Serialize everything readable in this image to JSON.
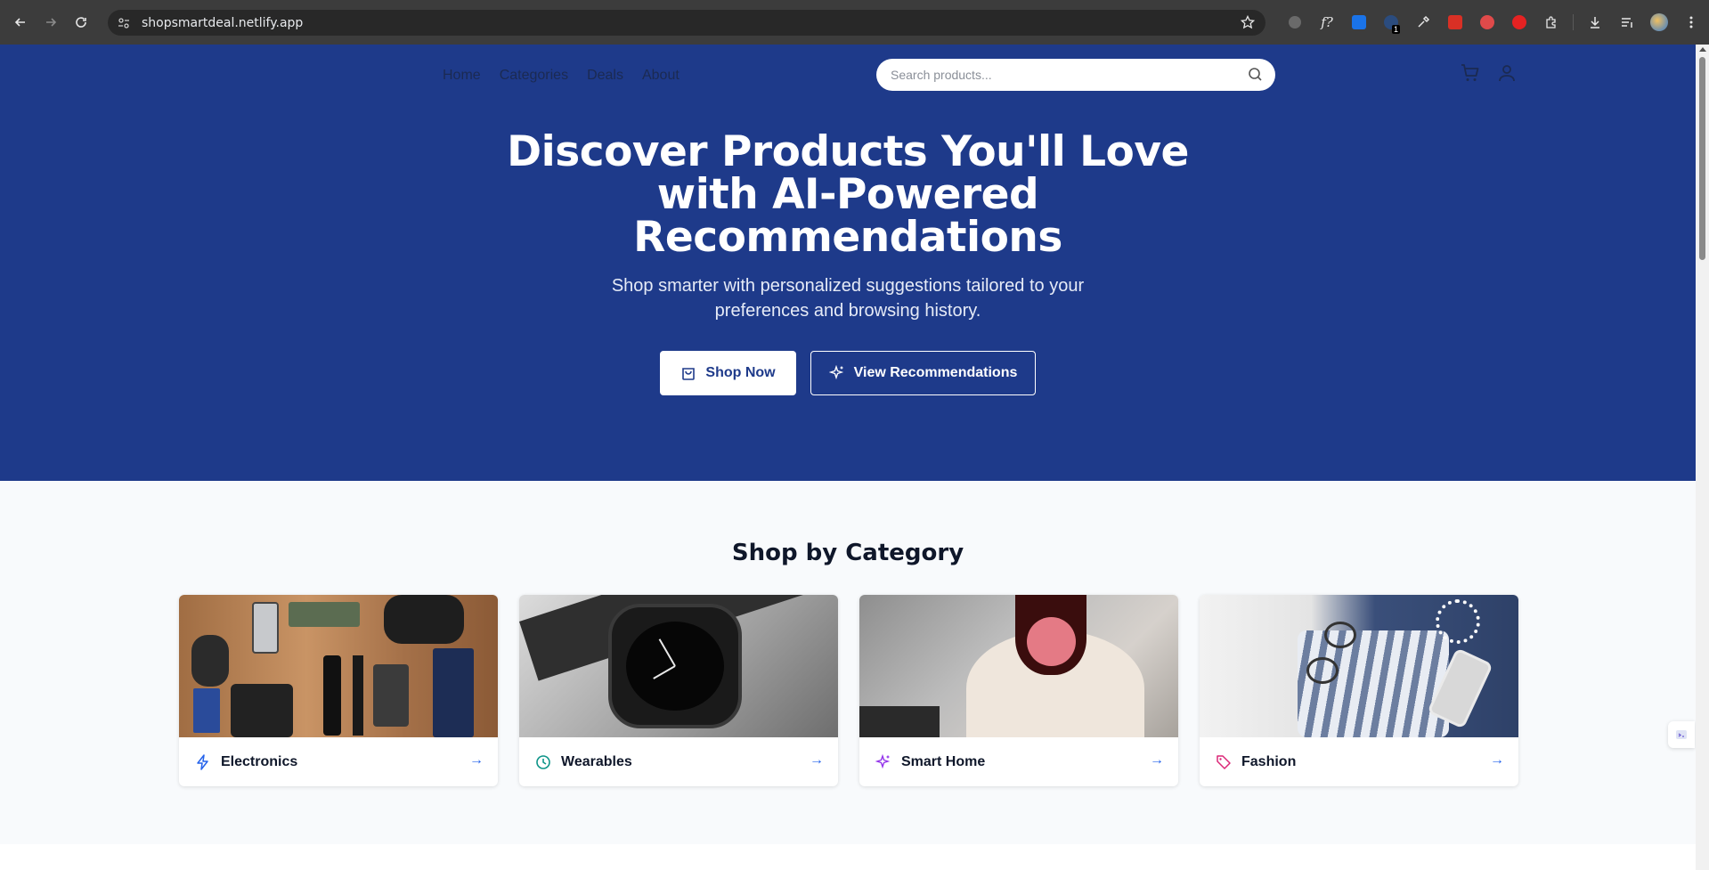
{
  "browser": {
    "url": "shopsmartdeal.netlify.app",
    "extension_badge": "1"
  },
  "nav": {
    "items": [
      {
        "label": "Home"
      },
      {
        "label": "Categories"
      },
      {
        "label": "Deals"
      },
      {
        "label": "About"
      }
    ],
    "search_placeholder": "Search products..."
  },
  "hero": {
    "title": "Discover Products You'll Love with AI-Powered Recommendations",
    "subtitle": "Shop smarter with personalized suggestions tailored to your preferences and browsing history.",
    "primary_button": "Shop Now",
    "secondary_button": "View Recommendations",
    "background_color": "#1e3a8a"
  },
  "categories": {
    "title": "Shop by Category",
    "items": [
      {
        "label": "Electronics",
        "icon": "lightning-icon",
        "icon_color": "#2563eb",
        "arrow": "→"
      },
      {
        "label": "Wearables",
        "icon": "clock-icon",
        "icon_color": "#0d9488",
        "arrow": "→"
      },
      {
        "label": "Smart Home",
        "icon": "sparkles-icon",
        "icon_color": "#9333ea",
        "arrow": "→"
      },
      {
        "label": "Fashion",
        "icon": "tag-icon",
        "icon_color": "#db2777",
        "arrow": "→"
      }
    ]
  }
}
